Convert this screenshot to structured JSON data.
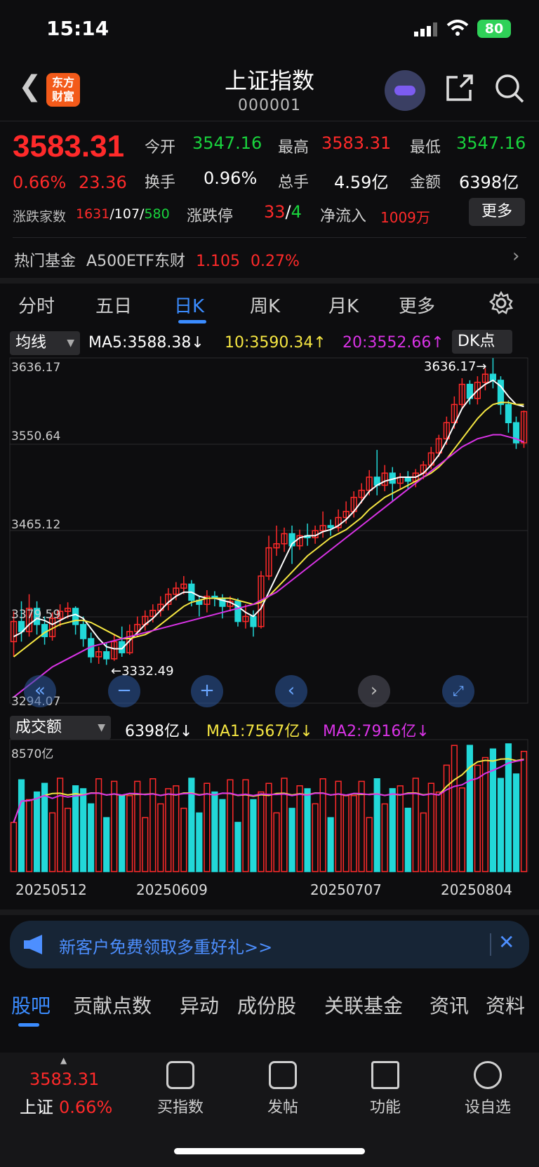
{
  "status": {
    "time": "15:14",
    "battery": "80"
  },
  "header": {
    "title": "上证指数",
    "code": "000001",
    "logo": "东方\n财富"
  },
  "quote": {
    "price": "3583.31",
    "change_pct": "0.66%",
    "change": "23.36",
    "open_label": "今开",
    "open": "3547.16",
    "high_label": "最高",
    "high": "3583.31",
    "low_label": "最低",
    "low": "3547.16",
    "turnover_label": "换手",
    "turnover": "0.96%",
    "volume_label": "总手",
    "volume": "4.59亿",
    "amount_label": "金额",
    "amount": "6398亿",
    "breadth_label": "涨跌家数",
    "breadth_up": "1631",
    "breadth_flat": "107",
    "breadth_down": "580",
    "limit_label": "涨跌停",
    "limit_up": "33",
    "limit_down": "4",
    "netflow_label": "净流入",
    "netflow": "1009万",
    "more": "更多"
  },
  "hotfund": {
    "label": "热门基金",
    "name": "A500ETF东财",
    "price": "1.105",
    "pct": "0.27%"
  },
  "tabs": [
    "分时",
    "五日",
    "日K",
    "周K",
    "月K",
    "更多"
  ],
  "active_tab": "日K",
  "ma": {
    "select": "均线",
    "ma5": "MA5:3588.38↓",
    "ma10": "10:3590.34↑",
    "ma20": "20:3552.66↑",
    "dk": "DK点"
  },
  "price_axis": [
    "3636.17",
    "3550.64",
    "3465.12",
    "3379.59",
    "3294.07"
  ],
  "annotations": {
    "high": "3636.17→",
    "low": "←3332.49"
  },
  "volume_panel": {
    "select": "成交额",
    "cur": "6398亿↓",
    "ma1": "MA1:7567亿↓",
    "ma2": "MA2:7916亿↓",
    "axis_top": "8570亿"
  },
  "dates": [
    "20250512",
    "20250609",
    "20250707",
    "20250804"
  ],
  "banner": "新客户免费领取多重好礼>>",
  "sub_tabs": [
    "股吧",
    "贡献点数",
    "异动",
    "成份股",
    "关联基金",
    "资讯",
    "资料"
  ],
  "bottom": {
    "price": "3583.31",
    "name": "上证",
    "pct": "0.66%",
    "items": [
      "买指数",
      "发帖",
      "功能",
      "设自选"
    ]
  },
  "colors": {
    "up": "#ff2a2a",
    "down": "#19d43d",
    "accent": "#3b8cff",
    "ma5": "#ffffff",
    "ma10": "#f5e642",
    "ma20": "#d933e6",
    "candle_down": "#22d8d8"
  },
  "chart_data": {
    "type": "candlestick",
    "ylim": [
      3294.07,
      3636.17
    ],
    "high": 3636.17,
    "low": 3332.49,
    "candles": [
      [
        3355,
        3375,
        3340,
        3385
      ],
      [
        3375,
        3365,
        3355,
        3395
      ],
      [
        3365,
        3388,
        3360,
        3402
      ],
      [
        3388,
        3372,
        3362,
        3395
      ],
      [
        3372,
        3360,
        3352,
        3380
      ],
      [
        3360,
        3378,
        3356,
        3384
      ],
      [
        3378,
        3385,
        3370,
        3392
      ],
      [
        3385,
        3388,
        3378,
        3394
      ],
      [
        3388,
        3372,
        3362,
        3390
      ],
      [
        3372,
        3358,
        3350,
        3380
      ],
      [
        3358,
        3340,
        3334,
        3364
      ],
      [
        3340,
        3345,
        3333,
        3350
      ],
      [
        3345,
        3338,
        3332,
        3354
      ],
      [
        3338,
        3355,
        3336,
        3362
      ],
      [
        3355,
        3344,
        3340,
        3370
      ],
      [
        3344,
        3365,
        3342,
        3372
      ],
      [
        3365,
        3372,
        3360,
        3380
      ],
      [
        3372,
        3380,
        3366,
        3386
      ],
      [
        3380,
        3386,
        3374,
        3392
      ],
      [
        3386,
        3392,
        3380,
        3400
      ],
      [
        3392,
        3402,
        3386,
        3408
      ],
      [
        3402,
        3408,
        3396,
        3414
      ],
      [
        3408,
        3412,
        3402,
        3420
      ],
      [
        3412,
        3396,
        3390,
        3416
      ],
      [
        3396,
        3392,
        3380,
        3400
      ],
      [
        3392,
        3400,
        3384,
        3406
      ],
      [
        3400,
        3398,
        3390,
        3405
      ],
      [
        3398,
        3390,
        3378,
        3402
      ],
      [
        3390,
        3395,
        3385,
        3400
      ],
      [
        3395,
        3375,
        3370,
        3398
      ],
      [
        3375,
        3380,
        3368,
        3392
      ],
      [
        3380,
        3370,
        3360,
        3386
      ],
      [
        3370,
        3420,
        3368,
        3425
      ],
      [
        3420,
        3448,
        3416,
        3460
      ],
      [
        3448,
        3452,
        3440,
        3470
      ],
      [
        3452,
        3462,
        3444,
        3468
      ],
      [
        3462,
        3450,
        3432,
        3470
      ],
      [
        3450,
        3460,
        3446,
        3466
      ],
      [
        3460,
        3458,
        3450,
        3472
      ],
      [
        3458,
        3465,
        3452,
        3470
      ],
      [
        3465,
        3470,
        3458,
        3484
      ],
      [
        3470,
        3468,
        3460,
        3476
      ],
      [
        3468,
        3478,
        3464,
        3486
      ],
      [
        3478,
        3484,
        3472,
        3494
      ],
      [
        3484,
        3498,
        3478,
        3504
      ],
      [
        3498,
        3505,
        3492,
        3512
      ],
      [
        3505,
        3518,
        3500,
        3525
      ],
      [
        3518,
        3510,
        3500,
        3545
      ],
      [
        3510,
        3522,
        3504,
        3530
      ],
      [
        3522,
        3512,
        3494,
        3528
      ],
      [
        3512,
        3518,
        3506,
        3522
      ],
      [
        3518,
        3514,
        3506,
        3524
      ],
      [
        3514,
        3522,
        3508,
        3526
      ],
      [
        3522,
        3530,
        3516,
        3534
      ],
      [
        3530,
        3542,
        3526,
        3548
      ],
      [
        3542,
        3556,
        3538,
        3560
      ],
      [
        3556,
        3572,
        3550,
        3578
      ],
      [
        3572,
        3590,
        3566,
        3598
      ],
      [
        3590,
        3610,
        3586,
        3616
      ],
      [
        3610,
        3596,
        3590,
        3614
      ],
      [
        3596,
        3612,
        3590,
        3618
      ],
      [
        3612,
        3620,
        3604,
        3626
      ],
      [
        3620,
        3614,
        3606,
        3636
      ],
      [
        3614,
        3590,
        3580,
        3618
      ],
      [
        3590,
        3572,
        3562,
        3594
      ],
      [
        3572,
        3552,
        3546,
        3578
      ],
      [
        3552,
        3583,
        3547,
        3584
      ]
    ],
    "ma5": [
      3360,
      3364,
      3372,
      3378,
      3376,
      3372,
      3376,
      3380,
      3382,
      3378,
      3368,
      3358,
      3350,
      3348,
      3348,
      3356,
      3364,
      3372,
      3378,
      3386,
      3394,
      3400,
      3404,
      3404,
      3400,
      3398,
      3398,
      3396,
      3394,
      3390,
      3384,
      3380,
      3388,
      3404,
      3420,
      3436,
      3452,
      3458,
      3460,
      3460,
      3464,
      3466,
      3470,
      3476,
      3484,
      3494,
      3504,
      3510,
      3514,
      3516,
      3518,
      3518,
      3518,
      3522,
      3530,
      3540,
      3554,
      3570,
      3586,
      3596,
      3604,
      3610,
      3614,
      3608,
      3598,
      3590,
      3588
    ],
    "ma10": [
      3340,
      3346,
      3352,
      3358,
      3364,
      3368,
      3372,
      3374,
      3376,
      3376,
      3374,
      3370,
      3366,
      3362,
      3358,
      3358,
      3360,
      3362,
      3366,
      3372,
      3378,
      3384,
      3390,
      3394,
      3396,
      3398,
      3398,
      3398,
      3398,
      3396,
      3394,
      3392,
      3394,
      3400,
      3408,
      3416,
      3424,
      3432,
      3440,
      3446,
      3452,
      3458,
      3462,
      3466,
      3472,
      3478,
      3486,
      3492,
      3498,
      3502,
      3506,
      3510,
      3514,
      3518,
      3522,
      3528,
      3536,
      3546,
      3556,
      3566,
      3576,
      3584,
      3590,
      3592,
      3592,
      3590,
      3590
    ],
    "ma20": [
      3300,
      3306,
      3312,
      3318,
      3324,
      3330,
      3334,
      3338,
      3342,
      3346,
      3350,
      3352,
      3354,
      3356,
      3358,
      3360,
      3362,
      3364,
      3366,
      3368,
      3370,
      3372,
      3374,
      3376,
      3378,
      3380,
      3382,
      3384,
      3386,
      3388,
      3390,
      3392,
      3396,
      3400,
      3404,
      3410,
      3416,
      3422,
      3428,
      3434,
      3440,
      3446,
      3452,
      3458,
      3464,
      3470,
      3476,
      3482,
      3488,
      3494,
      3500,
      3506,
      3512,
      3518,
      3524,
      3530,
      3536,
      3542,
      3548,
      3552,
      3556,
      3558,
      3560,
      3560,
      3558,
      3556,
      3552.66
    ]
  }
}
